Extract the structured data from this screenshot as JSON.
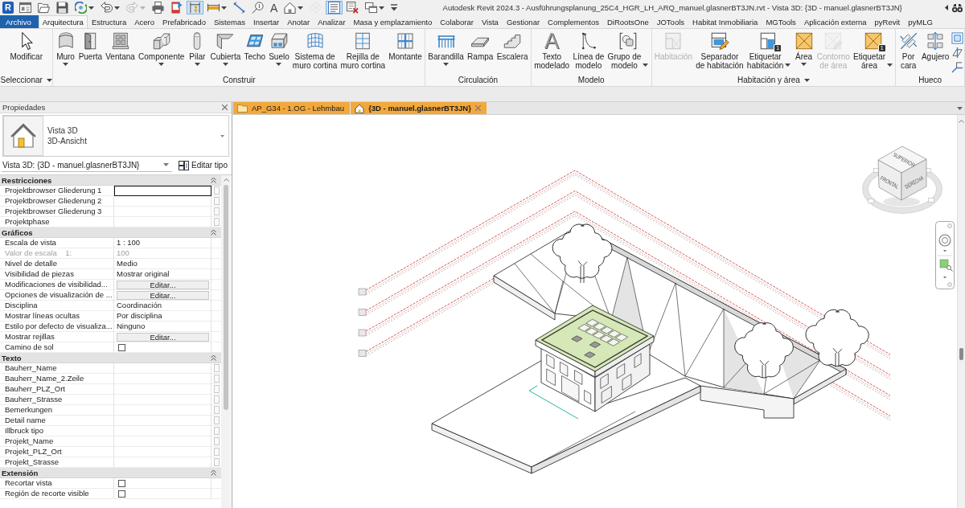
{
  "window": {
    "title": "Autodesk Revit 2024.3 - Ausführungsplanung_25C4_HGR_LH_ARQ_manuel.glasnerBT3JN.rvt - Vista 3D: {3D - manuel.glasnerBT3JN}"
  },
  "app_button": {
    "label": "R"
  },
  "quick_access": [
    {
      "kind": "home",
      "on": false,
      "menu": false,
      "disabled": false
    },
    {
      "kind": "open",
      "on": false,
      "menu": false,
      "disabled": false
    },
    {
      "kind": "save",
      "on": false,
      "menu": false,
      "disabled": false
    },
    {
      "kind": "sync",
      "on": false,
      "menu": true,
      "disabled": false
    },
    {
      "kind": "undo",
      "on": false,
      "menu": true,
      "disabled": false
    },
    {
      "kind": "redo",
      "on": false,
      "menu": true,
      "disabled": true
    },
    {
      "kind": "print",
      "on": false,
      "menu": false,
      "disabled": false
    },
    {
      "kind": "export",
      "on": false,
      "menu": false,
      "disabled": false
    },
    {
      "kind": "measure",
      "on": true,
      "menu": false,
      "disabled": false
    },
    {
      "kind": "dimension",
      "on": false,
      "menu": true,
      "disabled": false
    },
    {
      "kind": "align",
      "on": false,
      "menu": false,
      "disabled": false
    },
    {
      "kind": "tag",
      "on": false,
      "menu": false,
      "disabled": false
    },
    {
      "kind": "text",
      "glyph": "A",
      "on": false,
      "menu": false,
      "disabled": false
    },
    {
      "kind": "view3d",
      "on": false,
      "menu": true,
      "disabled": false
    },
    {
      "kind": "section",
      "on": false,
      "menu": false,
      "disabled": true
    },
    {
      "kind": "thinlines",
      "on": true,
      "menu": false,
      "disabled": false
    },
    {
      "kind": "closeviews",
      "on": false,
      "menu": false,
      "disabled": false
    },
    {
      "kind": "switchwindows",
      "on": false,
      "menu": true,
      "disabled": false
    },
    {
      "kind": "customize",
      "on": false,
      "menu": false,
      "disabled": false
    }
  ],
  "ribbon": {
    "tabs": [
      {
        "label": "Archivo",
        "kind": "file",
        "selected": false
      },
      {
        "label": "Arquitectura",
        "kind": "tab",
        "selected": true
      },
      {
        "label": "Estructura",
        "kind": "tab",
        "selected": false
      },
      {
        "label": "Acero",
        "kind": "tab",
        "selected": false
      },
      {
        "label": "Prefabricado",
        "kind": "tab",
        "selected": false
      },
      {
        "label": "Sistemas",
        "kind": "tab",
        "selected": false
      },
      {
        "label": "Insertar",
        "kind": "tab",
        "selected": false
      },
      {
        "label": "Anotar",
        "kind": "tab",
        "selected": false
      },
      {
        "label": "Analizar",
        "kind": "tab",
        "selected": false
      },
      {
        "label": "Masa y emplazamiento",
        "kind": "tab",
        "selected": false
      },
      {
        "label": "Colaborar",
        "kind": "tab",
        "selected": false
      },
      {
        "label": "Vista",
        "kind": "tab",
        "selected": false
      },
      {
        "label": "Gestionar",
        "kind": "tab",
        "selected": false
      },
      {
        "label": "Complementos",
        "kind": "tab",
        "selected": false
      },
      {
        "label": "DiRootsOne",
        "kind": "tab",
        "selected": false
      },
      {
        "label": "JOTools",
        "kind": "tab",
        "selected": false
      },
      {
        "label": "Habitat Inmobiliaria",
        "kind": "tab",
        "selected": false
      },
      {
        "label": "MGTools",
        "kind": "tab",
        "selected": false
      },
      {
        "label": "Aplicación externa",
        "kind": "tab",
        "selected": false
      },
      {
        "label": "pyRevit",
        "kind": "tab",
        "selected": false
      },
      {
        "label": "pyMLG",
        "kind": "tab",
        "selected": false
      }
    ],
    "panels": [
      {
        "title": "Seleccionar",
        "menu": true,
        "buttons": [
          {
            "label": "Modificar",
            "kind": "modify",
            "menu": false,
            "disabled": false
          }
        ]
      },
      {
        "title": "Construir",
        "menu": false,
        "buttons": [
          {
            "label": "Muro",
            "kind": "wall",
            "menu": true,
            "disabled": false
          },
          {
            "label": "Puerta",
            "kind": "door",
            "menu": false,
            "disabled": false
          },
          {
            "label": "Ventana",
            "kind": "window",
            "menu": false,
            "disabled": false
          },
          {
            "label": "Componente",
            "kind": "component",
            "menu": true,
            "disabled": false
          },
          {
            "label": "Pilar",
            "kind": "column",
            "menu": true,
            "disabled": false
          },
          {
            "label": "Cubierta",
            "kind": "roof",
            "menu": true,
            "disabled": false
          },
          {
            "label": "Techo",
            "kind": "ceiling",
            "menu": false,
            "disabled": false
          },
          {
            "label": "Suelo",
            "kind": "floor",
            "menu": true,
            "disabled": false
          },
          {
            "label": "Sistema de\nmuro cortina",
            "kind": "curtain-system",
            "menu": false,
            "disabled": false
          },
          {
            "label": "Rejilla de\nmuro cortina",
            "kind": "curtain-grid",
            "menu": false,
            "disabled": false
          },
          {
            "label": "Montante",
            "kind": "mullion",
            "menu": false,
            "disabled": false
          }
        ]
      },
      {
        "title": "Circulación",
        "menu": false,
        "buttons": [
          {
            "label": "Barandilla",
            "kind": "railing",
            "menu": true,
            "disabled": false
          },
          {
            "label": "Rampa",
            "kind": "ramp",
            "menu": false,
            "disabled": false
          },
          {
            "label": "Escalera",
            "kind": "stair",
            "menu": false,
            "disabled": false
          }
        ]
      },
      {
        "title": "Modelo",
        "menu": false,
        "buttons": [
          {
            "label": "Texto\nmodelado",
            "kind": "model-text",
            "glyph": "A",
            "menu": false,
            "disabled": false
          },
          {
            "label": "Línea de\nmodelo",
            "kind": "model-line",
            "menu": false,
            "disabled": false
          },
          {
            "label": "Grupo de\nmodelo",
            "kind": "model-group",
            "menu": true,
            "disabled": false
          }
        ]
      },
      {
        "title": "Habitación y área",
        "menu": true,
        "buttons": [
          {
            "label": "Habitación",
            "kind": "room",
            "menu": false,
            "disabled": true
          },
          {
            "label": "Separador\nde habitación",
            "kind": "room-separator",
            "menu": false,
            "disabled": false
          },
          {
            "label": "Etiquetar\nhabitación",
            "kind": "tag-room",
            "badge": "1",
            "menu": true,
            "disabled": false
          },
          {
            "label": "Área",
            "kind": "area",
            "menu": true,
            "disabled": false
          },
          {
            "label": "Contorno\nde área",
            "kind": "area-boundary",
            "menu": false,
            "disabled": true
          },
          {
            "label": "Etiquetar\nárea",
            "kind": "tag-area",
            "badge": "1",
            "menu": true,
            "disabled": false
          }
        ]
      },
      {
        "title": "Hueco",
        "menu": false,
        "buttons": [
          {
            "label": "Por\ncara",
            "kind": "by-face",
            "menu": false,
            "disabled": false
          },
          {
            "label": "Agujero",
            "kind": "shaft",
            "menu": false,
            "disabled": false
          }
        ],
        "small_buttons": [
          {
            "kind": "wall-opening"
          },
          {
            "kind": "vertical"
          },
          {
            "kind": "dormer"
          }
        ]
      }
    ]
  },
  "properties": {
    "title": "Propiedades",
    "type_selector": {
      "family": "Vista 3D",
      "type": "3D-Ansicht"
    },
    "instance": "Vista 3D: {3D - manuel.glasnerBT3JN}",
    "edit_type": "Editar tipo",
    "sections": [
      {
        "title": "Restricciones",
        "expanded": true,
        "rows": [
          {
            "name": "Projektbrowser Gliederung 1",
            "kind": "param",
            "editing": true
          },
          {
            "name": "Projektbrowser Gliederung 2",
            "kind": "param",
            "editing": false
          },
          {
            "name": "Projektbrowser Gliederung 3",
            "kind": "param",
            "editing": false
          },
          {
            "name": "Projektphase",
            "kind": "param",
            "editing": false
          }
        ]
      },
      {
        "title": "Gráficos",
        "expanded": true,
        "rows": [
          {
            "name": "Escala de vista",
            "kind": "value",
            "value": "1 : 100",
            "editing": false
          },
          {
            "name": "Valor de escala    1:",
            "kind": "readonly",
            "value": "100"
          },
          {
            "name": "Nivel de detalle",
            "kind": "value",
            "value": "Medio",
            "editing": false
          },
          {
            "name": "Visibilidad de piezas",
            "kind": "value",
            "value": "Mostrar original",
            "editing": false
          },
          {
            "name": "Modificaciones de visibilidad...",
            "kind": "button",
            "value": "Editar..."
          },
          {
            "name": "Opciones de visualización de ...",
            "kind": "button",
            "value": "Editar..."
          },
          {
            "name": "Disciplina",
            "kind": "value",
            "value": "Coordinación",
            "editing": false
          },
          {
            "name": "Mostrar líneas ocultas",
            "kind": "value",
            "value": "Por disciplina",
            "editing": false
          },
          {
            "name": "Estilo por defecto de visualiza...",
            "kind": "value",
            "value": "Ninguno",
            "editing": false
          },
          {
            "name": "Mostrar rejillas",
            "kind": "button",
            "value": "Editar..."
          },
          {
            "name": "Camino de sol",
            "kind": "checkbox",
            "checked": false
          }
        ]
      },
      {
        "title": "Texto",
        "expanded": true,
        "rows": [
          {
            "name": "Bauherr_Name",
            "kind": "param",
            "editing": false
          },
          {
            "name": "Bauherr_Name_2.Zeile",
            "kind": "param",
            "editing": false
          },
          {
            "name": "Bauherr_PLZ_Ort",
            "kind": "param",
            "editing": false
          },
          {
            "name": "Bauherr_Strasse",
            "kind": "param",
            "editing": false
          },
          {
            "name": "Bemerkungen",
            "kind": "param",
            "editing": false
          },
          {
            "name": "Detail name",
            "kind": "param",
            "editing": false
          },
          {
            "name": "Illbruck tipo",
            "kind": "param",
            "editing": false
          },
          {
            "name": "Projekt_Name",
            "kind": "param",
            "editing": false
          },
          {
            "name": "Projekt_PLZ_Ort",
            "kind": "param",
            "editing": false
          },
          {
            "name": "Projekt_Strasse",
            "kind": "param",
            "editing": false
          }
        ]
      },
      {
        "title": "Extensión",
        "expanded": true,
        "rows": [
          {
            "name": "Recortar vista",
            "kind": "checkbox",
            "checked": false
          },
          {
            "name": "Región de recorte visible",
            "kind": "checkbox",
            "checked": false
          }
        ]
      }
    ]
  },
  "view_tabs": [
    {
      "label": "AP_G34 - 1.OG - Lehmbau",
      "kind": "sheet",
      "selected": false
    },
    {
      "label": "{3D - manuel.glasnerBT3JN}",
      "kind": "model",
      "selected": true
    }
  ],
  "viewcube": {
    "faces": [
      "SUPERIOR",
      "FRONTAL",
      "DERECHA"
    ]
  }
}
